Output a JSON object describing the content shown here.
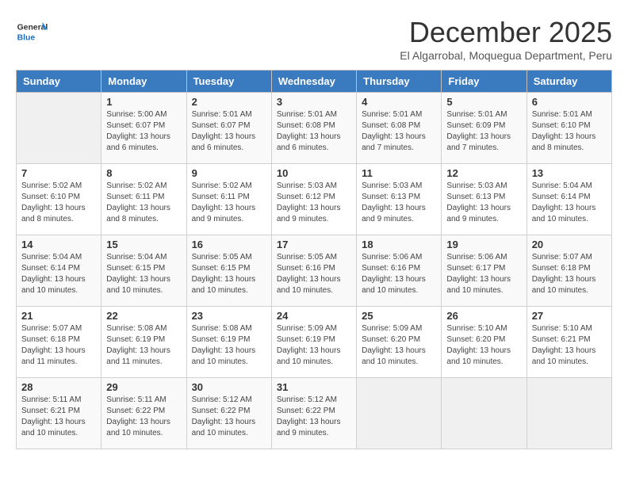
{
  "logo": {
    "general": "General",
    "blue": "Blue"
  },
  "header": {
    "month": "December 2025",
    "location": "El Algarrobal, Moquegua Department, Peru"
  },
  "days_of_week": [
    "Sunday",
    "Monday",
    "Tuesday",
    "Wednesday",
    "Thursday",
    "Friday",
    "Saturday"
  ],
  "weeks": [
    [
      {
        "day": "",
        "info": ""
      },
      {
        "day": "1",
        "info": "Sunrise: 5:00 AM\nSunset: 6:07 PM\nDaylight: 13 hours\nand 6 minutes."
      },
      {
        "day": "2",
        "info": "Sunrise: 5:01 AM\nSunset: 6:07 PM\nDaylight: 13 hours\nand 6 minutes."
      },
      {
        "day": "3",
        "info": "Sunrise: 5:01 AM\nSunset: 6:08 PM\nDaylight: 13 hours\nand 6 minutes."
      },
      {
        "day": "4",
        "info": "Sunrise: 5:01 AM\nSunset: 6:08 PM\nDaylight: 13 hours\nand 7 minutes."
      },
      {
        "day": "5",
        "info": "Sunrise: 5:01 AM\nSunset: 6:09 PM\nDaylight: 13 hours\nand 7 minutes."
      },
      {
        "day": "6",
        "info": "Sunrise: 5:01 AM\nSunset: 6:10 PM\nDaylight: 13 hours\nand 8 minutes."
      }
    ],
    [
      {
        "day": "7",
        "info": "Sunrise: 5:02 AM\nSunset: 6:10 PM\nDaylight: 13 hours\nand 8 minutes."
      },
      {
        "day": "8",
        "info": "Sunrise: 5:02 AM\nSunset: 6:11 PM\nDaylight: 13 hours\nand 8 minutes."
      },
      {
        "day": "9",
        "info": "Sunrise: 5:02 AM\nSunset: 6:11 PM\nDaylight: 13 hours\nand 9 minutes."
      },
      {
        "day": "10",
        "info": "Sunrise: 5:03 AM\nSunset: 6:12 PM\nDaylight: 13 hours\nand 9 minutes."
      },
      {
        "day": "11",
        "info": "Sunrise: 5:03 AM\nSunset: 6:13 PM\nDaylight: 13 hours\nand 9 minutes."
      },
      {
        "day": "12",
        "info": "Sunrise: 5:03 AM\nSunset: 6:13 PM\nDaylight: 13 hours\nand 9 minutes."
      },
      {
        "day": "13",
        "info": "Sunrise: 5:04 AM\nSunset: 6:14 PM\nDaylight: 13 hours\nand 10 minutes."
      }
    ],
    [
      {
        "day": "14",
        "info": "Sunrise: 5:04 AM\nSunset: 6:14 PM\nDaylight: 13 hours\nand 10 minutes."
      },
      {
        "day": "15",
        "info": "Sunrise: 5:04 AM\nSunset: 6:15 PM\nDaylight: 13 hours\nand 10 minutes."
      },
      {
        "day": "16",
        "info": "Sunrise: 5:05 AM\nSunset: 6:15 PM\nDaylight: 13 hours\nand 10 minutes."
      },
      {
        "day": "17",
        "info": "Sunrise: 5:05 AM\nSunset: 6:16 PM\nDaylight: 13 hours\nand 10 minutes."
      },
      {
        "day": "18",
        "info": "Sunrise: 5:06 AM\nSunset: 6:16 PM\nDaylight: 13 hours\nand 10 minutes."
      },
      {
        "day": "19",
        "info": "Sunrise: 5:06 AM\nSunset: 6:17 PM\nDaylight: 13 hours\nand 10 minutes."
      },
      {
        "day": "20",
        "info": "Sunrise: 5:07 AM\nSunset: 6:18 PM\nDaylight: 13 hours\nand 10 minutes."
      }
    ],
    [
      {
        "day": "21",
        "info": "Sunrise: 5:07 AM\nSunset: 6:18 PM\nDaylight: 13 hours\nand 11 minutes."
      },
      {
        "day": "22",
        "info": "Sunrise: 5:08 AM\nSunset: 6:19 PM\nDaylight: 13 hours\nand 11 minutes."
      },
      {
        "day": "23",
        "info": "Sunrise: 5:08 AM\nSunset: 6:19 PM\nDaylight: 13 hours\nand 10 minutes."
      },
      {
        "day": "24",
        "info": "Sunrise: 5:09 AM\nSunset: 6:19 PM\nDaylight: 13 hours\nand 10 minutes."
      },
      {
        "day": "25",
        "info": "Sunrise: 5:09 AM\nSunset: 6:20 PM\nDaylight: 13 hours\nand 10 minutes."
      },
      {
        "day": "26",
        "info": "Sunrise: 5:10 AM\nSunset: 6:20 PM\nDaylight: 13 hours\nand 10 minutes."
      },
      {
        "day": "27",
        "info": "Sunrise: 5:10 AM\nSunset: 6:21 PM\nDaylight: 13 hours\nand 10 minutes."
      }
    ],
    [
      {
        "day": "28",
        "info": "Sunrise: 5:11 AM\nSunset: 6:21 PM\nDaylight: 13 hours\nand 10 minutes."
      },
      {
        "day": "29",
        "info": "Sunrise: 5:11 AM\nSunset: 6:22 PM\nDaylight: 13 hours\nand 10 minutes."
      },
      {
        "day": "30",
        "info": "Sunrise: 5:12 AM\nSunset: 6:22 PM\nDaylight: 13 hours\nand 10 minutes."
      },
      {
        "day": "31",
        "info": "Sunrise: 5:12 AM\nSunset: 6:22 PM\nDaylight: 13 hours\nand 9 minutes."
      },
      {
        "day": "",
        "info": ""
      },
      {
        "day": "",
        "info": ""
      },
      {
        "day": "",
        "info": ""
      }
    ]
  ]
}
